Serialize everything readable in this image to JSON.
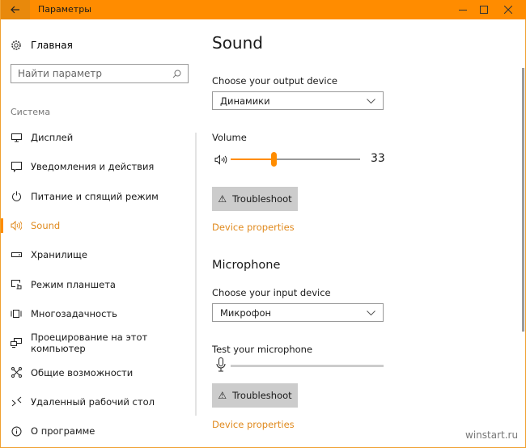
{
  "window": {
    "title": "Параметры",
    "back_icon": "arrow-left-icon",
    "controls": {
      "minimize": "minimize-icon",
      "maximize": "maximize-icon",
      "close": "close-icon"
    },
    "accent_color": "#ff8c00"
  },
  "sidebar": {
    "home_label": "Главная",
    "search_placeholder": "Найти параметр",
    "section_label": "Система",
    "items": [
      {
        "label": "Дисплей",
        "icon": "display-icon",
        "active": false
      },
      {
        "label": "Уведомления и действия",
        "icon": "notifications-icon",
        "active": false
      },
      {
        "label": "Питание и спящий режим",
        "icon": "power-icon",
        "active": false
      },
      {
        "label": "Sound",
        "icon": "speaker-icon",
        "active": true
      },
      {
        "label": "Хранилище",
        "icon": "storage-icon",
        "active": false
      },
      {
        "label": "Режим планшета",
        "icon": "tablet-mode-icon",
        "active": false
      },
      {
        "label": "Многозадачность",
        "icon": "multitasking-icon",
        "active": false
      },
      {
        "label": "Проецирование на этот компьютер",
        "icon": "projecting-icon",
        "active": false
      },
      {
        "label": "Общие возможности",
        "icon": "shared-experiences-icon",
        "active": false
      },
      {
        "label": "Удаленный рабочий стол",
        "icon": "remote-desktop-icon",
        "active": false
      },
      {
        "label": "О программе",
        "icon": "info-icon",
        "active": false
      }
    ]
  },
  "main": {
    "title": "Sound",
    "output": {
      "label": "Choose your output device",
      "selected": "Динамики",
      "volume_label": "Volume",
      "volume_value": 33,
      "volume_text": "33",
      "troubleshoot_label": "Troubleshoot",
      "device_properties_label": "Device properties"
    },
    "microphone": {
      "heading": "Microphone",
      "label": "Choose your input device",
      "selected": "Микрофон",
      "test_label": "Test your microphone",
      "level_value": 0,
      "troubleshoot_label": "Troubleshoot",
      "device_properties_label": "Device properties"
    }
  },
  "watermark": "winstart.ru"
}
